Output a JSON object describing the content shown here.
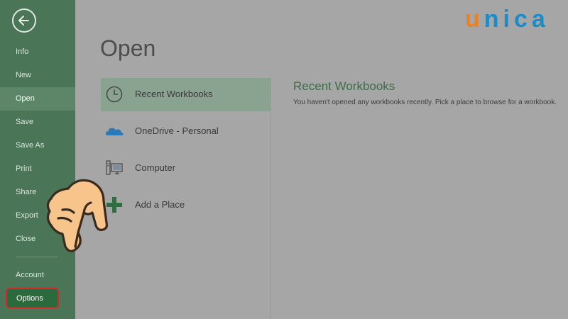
{
  "sidebar": {
    "items": [
      {
        "label": "Info"
      },
      {
        "label": "New"
      },
      {
        "label": "Open"
      },
      {
        "label": "Save"
      },
      {
        "label": "Save As"
      },
      {
        "label": "Print"
      },
      {
        "label": "Share"
      },
      {
        "label": "Export"
      },
      {
        "label": "Close"
      }
    ],
    "account_label": "Account",
    "options_label": "Options",
    "active_item": "Open"
  },
  "main": {
    "title": "Open",
    "places": [
      {
        "label": "Recent Workbooks",
        "icon": "clock-icon"
      },
      {
        "label": "OneDrive - Personal",
        "icon": "cloud-icon"
      },
      {
        "label": "Computer",
        "icon": "computer-icon"
      },
      {
        "label": "Add a Place",
        "icon": "plus-icon"
      }
    ],
    "recent": {
      "heading": "Recent Workbooks",
      "message": "You haven't opened any workbooks recently. Pick a place to browse for a workbook."
    }
  },
  "brand": {
    "logo_text": "unica"
  },
  "colors": {
    "sidebar_bg": "#4a7556",
    "active_item": "#5d8668",
    "options_bg": "#2a6a3c",
    "highlight_border": "#d8262d",
    "accent_green": "#3f6b4b",
    "logo_orange": "#f07f1f",
    "logo_blue": "#1a8cc9"
  }
}
